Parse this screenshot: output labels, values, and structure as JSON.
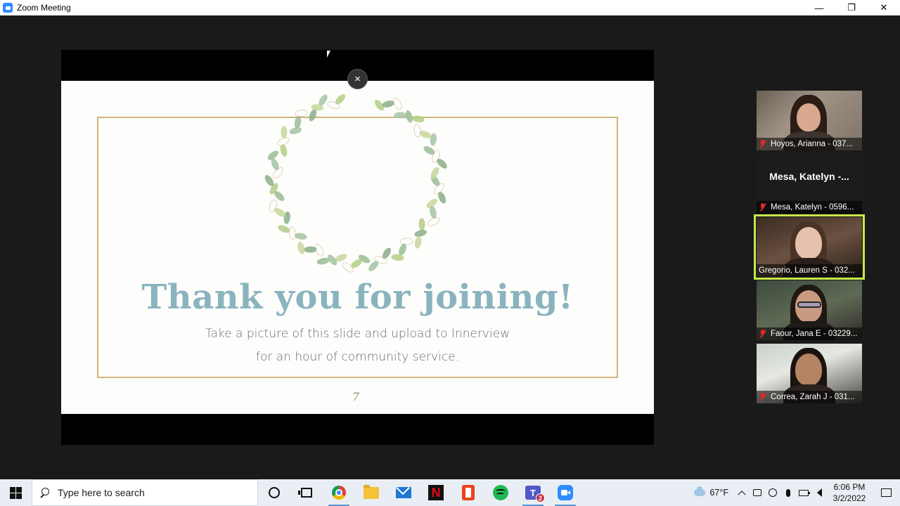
{
  "window": {
    "title": "Zoom Meeting",
    "minimize": "—",
    "restore": "❐",
    "close": "✕"
  },
  "share": {
    "close_glyph": "×"
  },
  "slide": {
    "headline": "Thank you for joining!",
    "line1": "Take a picture of this slide and upload to Innerview",
    "line2": "for an hour of community service.",
    "page_number": "7"
  },
  "participants": [
    {
      "label": "Hoyos, Arianna - 037...",
      "muted": true,
      "video": true
    },
    {
      "label": "Mesa, Katelyn - 0596...",
      "big_name": "Mesa, Katelyn -...",
      "muted": true,
      "video": false
    },
    {
      "label": "Gregorio, Lauren S - 032...",
      "muted": false,
      "video": true,
      "active_speaker": true
    },
    {
      "label": "Faour, Jana E - 03229...",
      "muted": true,
      "video": true
    },
    {
      "label": "Correa, Zarah J - 031...",
      "muted": true,
      "video": true
    }
  ],
  "taskbar": {
    "search_placeholder": "Type here to search",
    "teams_badge": "2",
    "weather_temp": "67°F",
    "time": "6:06 PM",
    "date": "3/2/2022"
  },
  "colors": {
    "active_speaker": "#c7e84a",
    "headline": "#8ab4bd",
    "frame_gold": "#cdb57a",
    "muted_red": "#e02828"
  }
}
